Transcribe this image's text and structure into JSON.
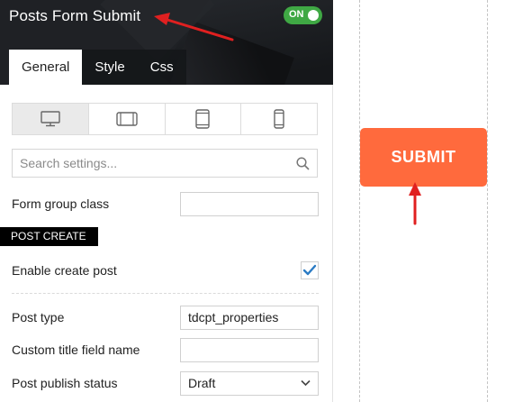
{
  "header": {
    "title": "Posts Form Submit",
    "toggle_label": "ON"
  },
  "tabs": [
    {
      "label": "General",
      "active": true
    },
    {
      "label": "Style",
      "active": false
    },
    {
      "label": "Css",
      "active": false
    }
  ],
  "devices": [
    "desktop-icon",
    "tablet-landscape-icon",
    "tablet-portrait-icon",
    "phone-icon"
  ],
  "search": {
    "placeholder": "Search settings..."
  },
  "form": {
    "form_group_class_label": "Form group class",
    "form_group_class_value": "",
    "section_title": "POST CREATE",
    "enable_create_post_label": "Enable create post",
    "enable_create_post_checked": true,
    "post_type_label": "Post type",
    "post_type_value": "tdcpt_properties",
    "custom_title_label": "Custom title field name",
    "custom_title_value": "",
    "publish_status_label": "Post publish status",
    "publish_status_value": "Draft"
  },
  "preview": {
    "submit_label": "SUBMIT"
  },
  "colors": {
    "header_bg": "#1f2125",
    "toggle_on": "#3fa844",
    "submit_bg": "#ff6a3d",
    "annotation_arrow": "#e02020",
    "checkbox_check": "#2b7bc4"
  }
}
